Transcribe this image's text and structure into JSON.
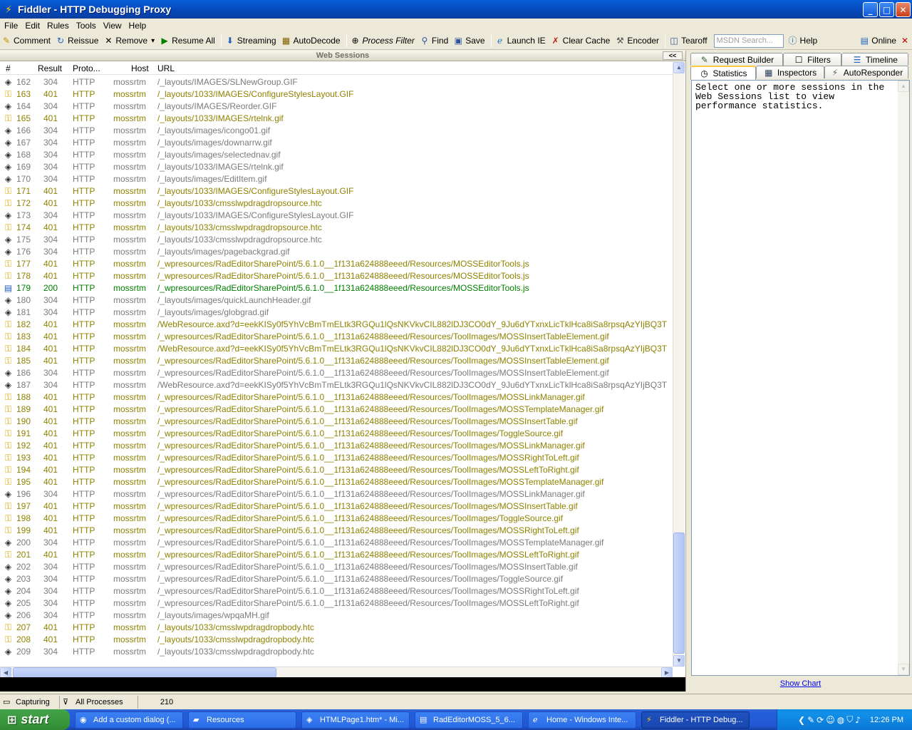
{
  "window": {
    "title": "Fiddler - HTTP Debugging Proxy",
    "minimize": "_",
    "maximize": "□",
    "close": "✕"
  },
  "menu": [
    "File",
    "Edit",
    "Rules",
    "Tools",
    "View",
    "Help"
  ],
  "toolbar": {
    "comment": "Comment",
    "reissue": "Reissue",
    "remove": "Remove",
    "remove_arrow": "▾",
    "resume_all": "Resume All",
    "streaming": "Streaming",
    "autodecode": "AutoDecode",
    "process_filter": "Process Filter",
    "find": "Find",
    "save": "Save",
    "launch_ie": "Launch IE",
    "clear_cache": "Clear Cache",
    "encoder": "Encoder",
    "tearoff": "Tearoff",
    "msdn_placeholder": "MSDN Search...",
    "help": "Help",
    "online": "Online",
    "close_x": "✕"
  },
  "sessions": {
    "caption": "Web Sessions",
    "collapse": "<<",
    "columns": {
      "num": "#",
      "result": "Result",
      "protocol": "Proto...",
      "host": "Host",
      "url": "URL"
    },
    "rows": [
      {
        "n": "162",
        "r": "304",
        "p": "HTTP",
        "h": "mossrtm",
        "u": "/_layouts/IMAGES/SLNewGroup.GIF"
      },
      {
        "n": "163",
        "r": "401",
        "p": "HTTP",
        "h": "mossrtm",
        "u": "/_layouts/1033/IMAGES/ConfigureStylesLayout.GIF"
      },
      {
        "n": "164",
        "r": "304",
        "p": "HTTP",
        "h": "mossrtm",
        "u": "/_layouts/IMAGES/Reorder.GIF"
      },
      {
        "n": "165",
        "r": "401",
        "p": "HTTP",
        "h": "mossrtm",
        "u": "/_layouts/1033/IMAGES/rtelnk.gif"
      },
      {
        "n": "166",
        "r": "304",
        "p": "HTTP",
        "h": "mossrtm",
        "u": "/_layouts/images/icongo01.gif"
      },
      {
        "n": "167",
        "r": "304",
        "p": "HTTP",
        "h": "mossrtm",
        "u": "/_layouts/images/downarrw.gif"
      },
      {
        "n": "168",
        "r": "304",
        "p": "HTTP",
        "h": "mossrtm",
        "u": "/_layouts/images/selectednav.gif"
      },
      {
        "n": "169",
        "r": "304",
        "p": "HTTP",
        "h": "mossrtm",
        "u": "/_layouts/1033/IMAGES/rtelnk.gif"
      },
      {
        "n": "170",
        "r": "304",
        "p": "HTTP",
        "h": "mossrtm",
        "u": "/_layouts/images/EditItem.gif"
      },
      {
        "n": "171",
        "r": "401",
        "p": "HTTP",
        "h": "mossrtm",
        "u": "/_layouts/1033/IMAGES/ConfigureStylesLayout.GIF"
      },
      {
        "n": "172",
        "r": "401",
        "p": "HTTP",
        "h": "mossrtm",
        "u": "/_layouts/1033/cmsslwpdragdropsource.htc"
      },
      {
        "n": "173",
        "r": "304",
        "p": "HTTP",
        "h": "mossrtm",
        "u": "/_layouts/1033/IMAGES/ConfigureStylesLayout.GIF"
      },
      {
        "n": "174",
        "r": "401",
        "p": "HTTP",
        "h": "mossrtm",
        "u": "/_layouts/1033/cmsslwpdragdropsource.htc"
      },
      {
        "n": "175",
        "r": "304",
        "p": "HTTP",
        "h": "mossrtm",
        "u": "/_layouts/1033/cmsslwpdragdropsource.htc"
      },
      {
        "n": "176",
        "r": "304",
        "p": "HTTP",
        "h": "mossrtm",
        "u": "/_layouts/images/pagebackgrad.gif"
      },
      {
        "n": "177",
        "r": "401",
        "p": "HTTP",
        "h": "mossrtm",
        "u": "/_wpresources/RadEditorSharePoint/5.6.1.0__1f131a624888eeed/Resources/MOSSEditorTools.js"
      },
      {
        "n": "178",
        "r": "401",
        "p": "HTTP",
        "h": "mossrtm",
        "u": "/_wpresources/RadEditorSharePoint/5.6.1.0__1f131a624888eeed/Resources/MOSSEditorTools.js"
      },
      {
        "n": "179",
        "r": "200",
        "p": "HTTP",
        "h": "mossrtm",
        "u": "/_wpresources/RadEditorSharePoint/5.6.1.0__1f131a624888eeed/Resources/MOSSEditorTools.js"
      },
      {
        "n": "180",
        "r": "304",
        "p": "HTTP",
        "h": "mossrtm",
        "u": "/_layouts/images/quickLaunchHeader.gif"
      },
      {
        "n": "181",
        "r": "304",
        "p": "HTTP",
        "h": "mossrtm",
        "u": "/_layouts/images/globgrad.gif"
      },
      {
        "n": "182",
        "r": "401",
        "p": "HTTP",
        "h": "mossrtm",
        "u": "/WebResource.axd?d=eekKISy0f5YhVcBmTmELtk3RGQu1lQsNKVkvCIL882lDJ3CO0dY_9Ju6dYTxnxLicTklHca8iSa8rpsqAzYIjBQ3T"
      },
      {
        "n": "183",
        "r": "401",
        "p": "HTTP",
        "h": "mossrtm",
        "u": "/_wpresources/RadEditorSharePoint/5.6.1.0__1f131a624888eeed/Resources/ToolImages/MOSSInsertTableElement.gif"
      },
      {
        "n": "184",
        "r": "401",
        "p": "HTTP",
        "h": "mossrtm",
        "u": "/WebResource.axd?d=eekKISy0f5YhVcBmTmELtk3RGQu1lQsNKVkvCIL882lDJ3CO0dY_9Ju6dYTxnxLicTklHca8iSa8rpsqAzYIjBQ3T"
      },
      {
        "n": "185",
        "r": "401",
        "p": "HTTP",
        "h": "mossrtm",
        "u": "/_wpresources/RadEditorSharePoint/5.6.1.0__1f131a624888eeed/Resources/ToolImages/MOSSInsertTableElement.gif"
      },
      {
        "n": "186",
        "r": "304",
        "p": "HTTP",
        "h": "mossrtm",
        "u": "/_wpresources/RadEditorSharePoint/5.6.1.0__1f131a624888eeed/Resources/ToolImages/MOSSInsertTableElement.gif"
      },
      {
        "n": "187",
        "r": "304",
        "p": "HTTP",
        "h": "mossrtm",
        "u": "/WebResource.axd?d=eekKISy0f5YhVcBmTmELtk3RGQu1lQsNKVkvCIL882lDJ3CO0dY_9Ju6dYTxnxLicTklHca8iSa8rpsqAzYIjBQ3T"
      },
      {
        "n": "188",
        "r": "401",
        "p": "HTTP",
        "h": "mossrtm",
        "u": "/_wpresources/RadEditorSharePoint/5.6.1.0__1f131a624888eeed/Resources/ToolImages/MOSSLinkManager.gif"
      },
      {
        "n": "189",
        "r": "401",
        "p": "HTTP",
        "h": "mossrtm",
        "u": "/_wpresources/RadEditorSharePoint/5.6.1.0__1f131a624888eeed/Resources/ToolImages/MOSSTemplateManager.gif"
      },
      {
        "n": "190",
        "r": "401",
        "p": "HTTP",
        "h": "mossrtm",
        "u": "/_wpresources/RadEditorSharePoint/5.6.1.0__1f131a624888eeed/Resources/ToolImages/MOSSInsertTable.gif"
      },
      {
        "n": "191",
        "r": "401",
        "p": "HTTP",
        "h": "mossrtm",
        "u": "/_wpresources/RadEditorSharePoint/5.6.1.0__1f131a624888eeed/Resources/ToolImages/ToggleSource.gif"
      },
      {
        "n": "192",
        "r": "401",
        "p": "HTTP",
        "h": "mossrtm",
        "u": "/_wpresources/RadEditorSharePoint/5.6.1.0__1f131a624888eeed/Resources/ToolImages/MOSSLinkManager.gif"
      },
      {
        "n": "193",
        "r": "401",
        "p": "HTTP",
        "h": "mossrtm",
        "u": "/_wpresources/RadEditorSharePoint/5.6.1.0__1f131a624888eeed/Resources/ToolImages/MOSSRightToLeft.gif"
      },
      {
        "n": "194",
        "r": "401",
        "p": "HTTP",
        "h": "mossrtm",
        "u": "/_wpresources/RadEditorSharePoint/5.6.1.0__1f131a624888eeed/Resources/ToolImages/MOSSLeftToRight.gif"
      },
      {
        "n": "195",
        "r": "401",
        "p": "HTTP",
        "h": "mossrtm",
        "u": "/_wpresources/RadEditorSharePoint/5.6.1.0__1f131a624888eeed/Resources/ToolImages/MOSSTemplateManager.gif"
      },
      {
        "n": "196",
        "r": "304",
        "p": "HTTP",
        "h": "mossrtm",
        "u": "/_wpresources/RadEditorSharePoint/5.6.1.0__1f131a624888eeed/Resources/ToolImages/MOSSLinkManager.gif"
      },
      {
        "n": "197",
        "r": "401",
        "p": "HTTP",
        "h": "mossrtm",
        "u": "/_wpresources/RadEditorSharePoint/5.6.1.0__1f131a624888eeed/Resources/ToolImages/MOSSInsertTable.gif"
      },
      {
        "n": "198",
        "r": "401",
        "p": "HTTP",
        "h": "mossrtm",
        "u": "/_wpresources/RadEditorSharePoint/5.6.1.0__1f131a624888eeed/Resources/ToolImages/ToggleSource.gif"
      },
      {
        "n": "199",
        "r": "401",
        "p": "HTTP",
        "h": "mossrtm",
        "u": "/_wpresources/RadEditorSharePoint/5.6.1.0__1f131a624888eeed/Resources/ToolImages/MOSSRightToLeft.gif"
      },
      {
        "n": "200",
        "r": "304",
        "p": "HTTP",
        "h": "mossrtm",
        "u": "/_wpresources/RadEditorSharePoint/5.6.1.0__1f131a624888eeed/Resources/ToolImages/MOSSTemplateManager.gif"
      },
      {
        "n": "201",
        "r": "401",
        "p": "HTTP",
        "h": "mossrtm",
        "u": "/_wpresources/RadEditorSharePoint/5.6.1.0__1f131a624888eeed/Resources/ToolImages/MOSSLeftToRight.gif"
      },
      {
        "n": "202",
        "r": "304",
        "p": "HTTP",
        "h": "mossrtm",
        "u": "/_wpresources/RadEditorSharePoint/5.6.1.0__1f131a624888eeed/Resources/ToolImages/MOSSInsertTable.gif"
      },
      {
        "n": "203",
        "r": "304",
        "p": "HTTP",
        "h": "mossrtm",
        "u": "/_wpresources/RadEditorSharePoint/5.6.1.0__1f131a624888eeed/Resources/ToolImages/ToggleSource.gif"
      },
      {
        "n": "204",
        "r": "304",
        "p": "HTTP",
        "h": "mossrtm",
        "u": "/_wpresources/RadEditorSharePoint/5.6.1.0__1f131a624888eeed/Resources/ToolImages/MOSSRightToLeft.gif"
      },
      {
        "n": "205",
        "r": "304",
        "p": "HTTP",
        "h": "mossrtm",
        "u": "/_wpresources/RadEditorSharePoint/5.6.1.0__1f131a624888eeed/Resources/ToolImages/MOSSLeftToRight.gif"
      },
      {
        "n": "206",
        "r": "304",
        "p": "HTTP",
        "h": "mossrtm",
        "u": "/_layouts/images/wpqaMH.gif"
      },
      {
        "n": "207",
        "r": "401",
        "p": "HTTP",
        "h": "mossrtm",
        "u": "/_layouts/1033/cmsslwpdragdropbody.htc"
      },
      {
        "n": "208",
        "r": "401",
        "p": "HTTP",
        "h": "mossrtm",
        "u": "/_layouts/1033/cmsslwpdragdropbody.htc"
      },
      {
        "n": "209",
        "r": "304",
        "p": "HTTP",
        "h": "mossrtm",
        "u": "/_layouts/1033/cmsslwpdragdropbody.htc"
      }
    ]
  },
  "right_tabs": {
    "top": [
      "Request Builder",
      "Filters",
      "Timeline"
    ],
    "bottom": [
      "Statistics",
      "Inspectors",
      "AutoResponder"
    ]
  },
  "statistics": {
    "message": "Select one or more sessions in the\nWeb Sessions list to view\nperformance statistics.",
    "show_chart": "Show Chart"
  },
  "statusbar": {
    "capturing": "Capturing",
    "processes": "All Processes",
    "count": "210"
  },
  "taskbar": {
    "start": "start",
    "tasks": [
      "Add a custom dialog (...",
      "Resources",
      "HTMLPage1.htm* - Mi...",
      "RadEditorMOSS_5_6...",
      "Home - Windows Inte...",
      "Fiddler - HTTP Debug..."
    ],
    "clock": "12:26 PM"
  },
  "colors": {
    "status_304": "#7b7b7b",
    "status_401": "#8f8200",
    "status_200": "#008000"
  }
}
